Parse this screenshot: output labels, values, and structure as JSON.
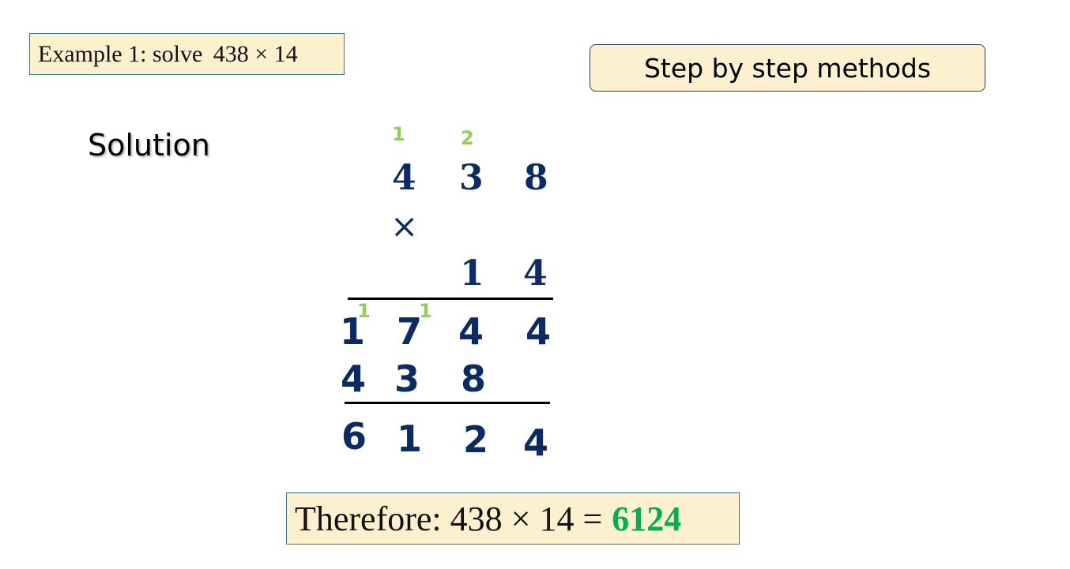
{
  "example": {
    "prefix": "Example 1: solve ",
    "expression": "438 × 14"
  },
  "methods_button": {
    "label": "Step by step methods"
  },
  "solution_heading": "Solution",
  "multiplication": {
    "carries_top": [
      "1",
      "2"
    ],
    "multiplicand": [
      "4",
      "3",
      "8"
    ],
    "operator": "×",
    "multiplier": [
      "1",
      "4"
    ],
    "partial_1_carries": [
      "1",
      "1"
    ],
    "partial_1": [
      "1",
      "7",
      "4",
      "4"
    ],
    "partial_2": [
      "4",
      "3",
      "8"
    ],
    "result": [
      "6",
      "1",
      "2",
      "4"
    ]
  },
  "conclusion": {
    "prefix": "Therefore: 438 × 14 =",
    "answer": "6124"
  },
  "colors": {
    "box_fill": "#fdf0cf",
    "box_border": "#2e75b6",
    "digits": "#0c2a63",
    "carries": "#92d050",
    "answer": "#00b050"
  }
}
